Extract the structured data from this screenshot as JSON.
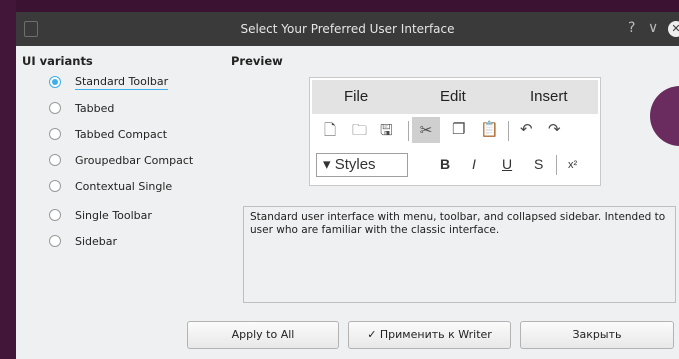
{
  "window": {
    "title": "Select Your Preferred User Interface",
    "help_icon": "?",
    "menu_icon": "∨",
    "close_icon": "✕"
  },
  "ui_variants": {
    "title": "UI variants",
    "items": [
      {
        "label": "Standard Toolbar",
        "selected": true
      },
      {
        "label": "Tabbed",
        "selected": false
      },
      {
        "label": "Tabbed Compact",
        "selected": false
      },
      {
        "label": "Groupedbar Compact",
        "selected": false
      },
      {
        "label": "Contextual Single",
        "selected": false
      },
      {
        "label": "Single Toolbar",
        "selected": false
      },
      {
        "label": "Sidebar",
        "selected": false
      }
    ]
  },
  "preview": {
    "title": "Preview",
    "menu": {
      "file": "File",
      "edit": "Edit",
      "insert": "Insert"
    },
    "style_box": "Styles",
    "format": {
      "bold": "B",
      "italic": "I",
      "underline": "U",
      "strike": "S",
      "superscript": "x²"
    }
  },
  "description": "Standard user interface with menu, toolbar, and collapsed sidebar. Intended to user who are familiar with the classic interface.",
  "buttons": {
    "apply_all": "Apply to All",
    "apply_writer": "Применить к Writer",
    "close": "Закрыть"
  },
  "colors": {
    "accent": "#3daee9",
    "titlebar": "#3a3a3a",
    "dialog_bg": "#eff0f1"
  }
}
